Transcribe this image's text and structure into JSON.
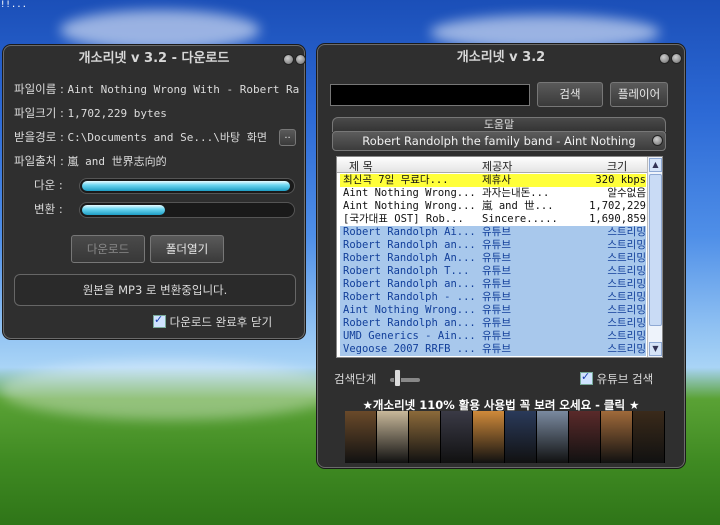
{
  "desktop": {
    "corner_text": "!!..."
  },
  "download_window": {
    "title": "개소리넷 v 3.2 - 다운로드",
    "fields": [
      {
        "label": "파일이름 :",
        "value": "Aint Nothing Wrong With - Robert Ra"
      },
      {
        "label": "파일크기 :",
        "value": "1,702,229 bytes"
      },
      {
        "label": "받을경로 :",
        "value": "C:\\Documents and Se...\\바탕 화면"
      },
      {
        "label": "파일출처 :",
        "value": "嵐 and 世界志向的"
      }
    ],
    "browse_label": "..",
    "download_progress_label": "다운 :",
    "convert_progress_label": "변환 :",
    "download_progress": 1.0,
    "convert_progress": 0.4,
    "download_button": "다운로드",
    "open_folder_button": "폴더열기",
    "status": "원본을 MP3 로 변환중입니다.",
    "close_after_label": "다운로드 완료후 닫기"
  },
  "main_window": {
    "title": "개소리넷 v 3.2",
    "search_value": "",
    "search_button": "검색",
    "player_button": "플레이어",
    "help_tab": "도움말",
    "now_playing": "Robert Randolph  the family band - Aint Nothing",
    "columns": [
      "제 목",
      "제공자",
      "크기"
    ],
    "rows": [
      {
        "title": "최신곡 7일 무료다...",
        "provider": "제휴사",
        "size": "320 kbps",
        "style": "hl"
      },
      {
        "title": "Aint Nothing Wrong...",
        "provider": "과자는내돈...",
        "size": "알수없음",
        "style": ""
      },
      {
        "title": "Aint Nothing Wrong...",
        "provider": "嵐 and 世...",
        "size": "1,702,229",
        "style": ""
      },
      {
        "title": "[국가대표 OST] Rob...",
        "provider": "Sincere.....",
        "size": "1,690,859",
        "style": ""
      },
      {
        "title": "Robert Randolph Ai...",
        "provider": "유튜브",
        "size": "스트리밍",
        "style": "sel"
      },
      {
        "title": "Robert Randolph an...",
        "provider": "유튜브",
        "size": "스트리밍",
        "style": "sel"
      },
      {
        "title": "Robert Randolph An...",
        "provider": "유튜브",
        "size": "스트리밍",
        "style": "sel"
      },
      {
        "title": "Robert Randolph  T...",
        "provider": "유튜브",
        "size": "스트리밍",
        "style": "sel"
      },
      {
        "title": "Robert Randolph an...",
        "provider": "유튜브",
        "size": "스트리밍",
        "style": "sel"
      },
      {
        "title": "Robert Randolph - ...",
        "provider": "유튜브",
        "size": "스트리밍",
        "style": "sel"
      },
      {
        "title": "Aint Nothing Wrong...",
        "provider": "유튜브",
        "size": "스트리밍",
        "style": "sel"
      },
      {
        "title": "Robert Randolph an...",
        "provider": "유튜브",
        "size": "스트리밍",
        "style": "sel"
      },
      {
        "title": "UMD Generics - Ain...",
        "provider": "유튜브",
        "size": "스트리밍",
        "style": "sel"
      },
      {
        "title": "Vegoose 2007 RRFB ...",
        "provider": "유튜브",
        "size": "스트리밍",
        "style": "sel"
      }
    ],
    "search_depth_label": "검색단계",
    "youtube_search_label": "유튜브 검색",
    "promo": "★개소리넷 110% 활용 사용법 꼭 보려 오세요 - 클릭 ★",
    "thumbnail_colors": [
      "#6a4a2a",
      "#c8b89a",
      "#8c6a3a",
      "#3a3a46",
      "#d08a3a",
      "#2a3a5a",
      "#7a8aa0",
      "#5a2a2a",
      "#a06a3a",
      "#3a2a1a"
    ]
  }
}
